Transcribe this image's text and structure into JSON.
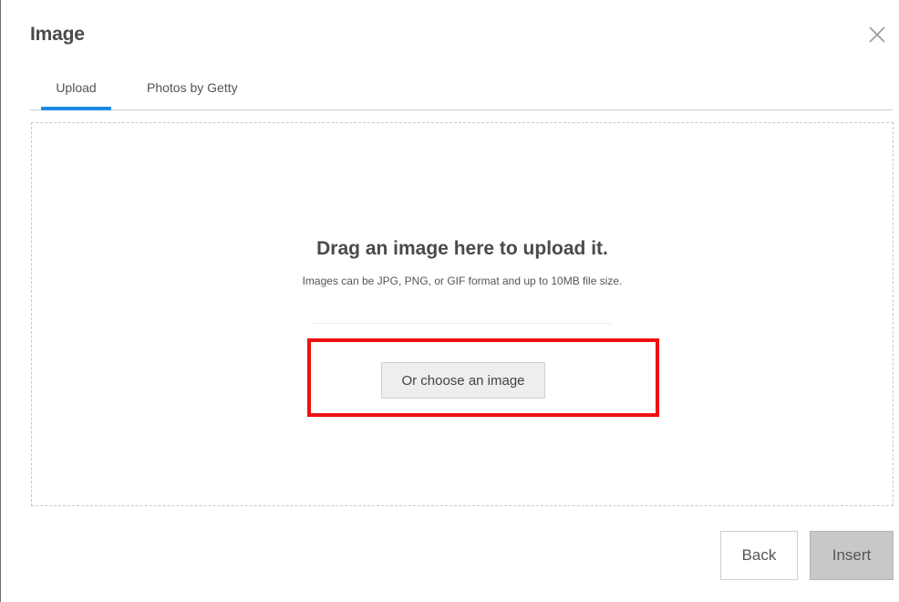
{
  "dialog": {
    "title": "Image"
  },
  "tabs": [
    {
      "label": "Upload",
      "active": true
    },
    {
      "label": "Photos by Getty",
      "active": false
    }
  ],
  "dropzone": {
    "heading": "Drag an image here to upload it.",
    "subtext": "Images can be JPG, PNG, or GIF format and up to 10MB file size.",
    "choose_label": "Or choose an image"
  },
  "footer": {
    "back_label": "Back",
    "insert_label": "Insert"
  },
  "colors": {
    "accent": "#1e88e5",
    "highlight": "#ee1111"
  },
  "icons": {
    "close": "close-icon"
  }
}
